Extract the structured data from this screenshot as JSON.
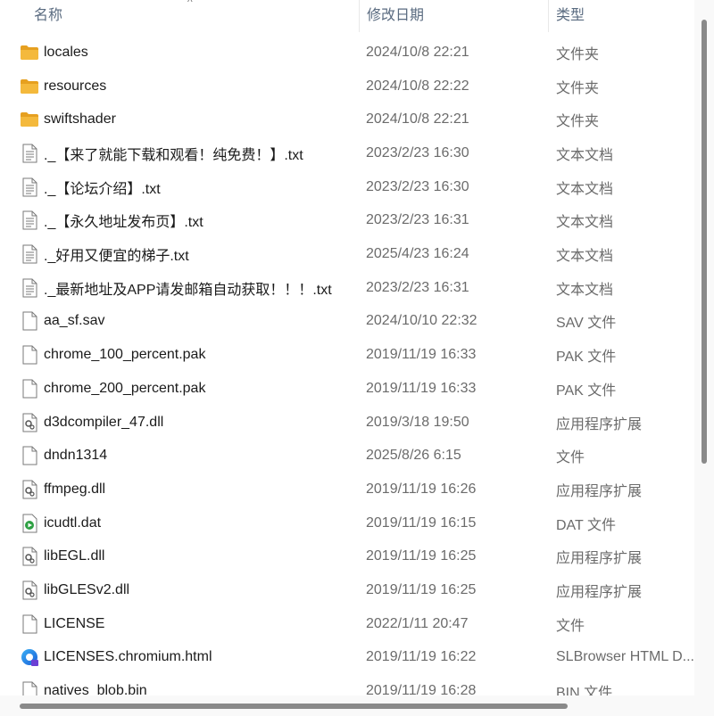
{
  "columns": {
    "name": "名称",
    "date": "修改日期",
    "type": "类型",
    "sort_indicator": "^"
  },
  "files": [
    {
      "name": "locales",
      "date": "2024/10/8 22:21",
      "type": "文件夹",
      "icon": "folder-icon"
    },
    {
      "name": "resources",
      "date": "2024/10/8 22:22",
      "type": "文件夹",
      "icon": "folder-icon"
    },
    {
      "name": "swiftshader",
      "date": "2024/10/8 22:21",
      "type": "文件夹",
      "icon": "folder-icon"
    },
    {
      "name": "._【来了就能下载和观看！纯免费！】.txt",
      "date": "2023/2/23 16:30",
      "type": "文本文档",
      "icon": "text-file-icon"
    },
    {
      "name": "._【论坛介绍】.txt",
      "date": "2023/2/23 16:30",
      "type": "文本文档",
      "icon": "text-file-icon"
    },
    {
      "name": "._【永久地址发布页】.txt",
      "date": "2023/2/23 16:31",
      "type": "文本文档",
      "icon": "text-file-icon"
    },
    {
      "name": "._好用又便宜的梯子.txt",
      "date": "2025/4/23 16:24",
      "type": "文本文档",
      "icon": "text-file-icon"
    },
    {
      "name": "._最新地址及APP请发邮箱自动获取！！！.txt",
      "date": "2023/2/23 16:31",
      "type": "文本文档",
      "icon": "text-file-icon"
    },
    {
      "name": "aa_sf.sav",
      "date": "2024/10/10 22:32",
      "type": "SAV 文件",
      "icon": "blank-file-icon"
    },
    {
      "name": "chrome_100_percent.pak",
      "date": "2019/11/19 16:33",
      "type": "PAK 文件",
      "icon": "blank-file-icon"
    },
    {
      "name": "chrome_200_percent.pak",
      "date": "2019/11/19 16:33",
      "type": "PAK 文件",
      "icon": "blank-file-icon"
    },
    {
      "name": "d3dcompiler_47.dll",
      "date": "2019/3/18 19:50",
      "type": "应用程序扩展",
      "icon": "dll-file-icon"
    },
    {
      "name": "dndn1314",
      "date": "2025/8/26 6:15",
      "type": "文件",
      "icon": "blank-file-icon"
    },
    {
      "name": "ffmpeg.dll",
      "date": "2019/11/19 16:26",
      "type": "应用程序扩展",
      "icon": "dll-file-icon"
    },
    {
      "name": "icudtl.dat",
      "date": "2019/11/19 16:15",
      "type": "DAT 文件",
      "icon": "media-file-icon"
    },
    {
      "name": "libEGL.dll",
      "date": "2019/11/19 16:25",
      "type": "应用程序扩展",
      "icon": "dll-file-icon"
    },
    {
      "name": "libGLESv2.dll",
      "date": "2019/11/19 16:25",
      "type": "应用程序扩展",
      "icon": "dll-file-icon"
    },
    {
      "name": "LICENSE",
      "date": "2022/1/11 20:47",
      "type": "文件",
      "icon": "blank-file-icon"
    },
    {
      "name": "LICENSES.chromium.html",
      "date": "2019/11/19 16:22",
      "type": "SLBrowser HTML D...",
      "icon": "browser-html-icon"
    },
    {
      "name": "natives_blob.bin",
      "date": "2019/11/19 16:28",
      "type": "BIN 文件",
      "icon": "blank-file-icon"
    }
  ],
  "colors": {
    "folder": "#f4b93c",
    "folder_dark": "#e6a020",
    "header_text": "#5a6b80",
    "secondary_text": "#6b6b6b"
  }
}
